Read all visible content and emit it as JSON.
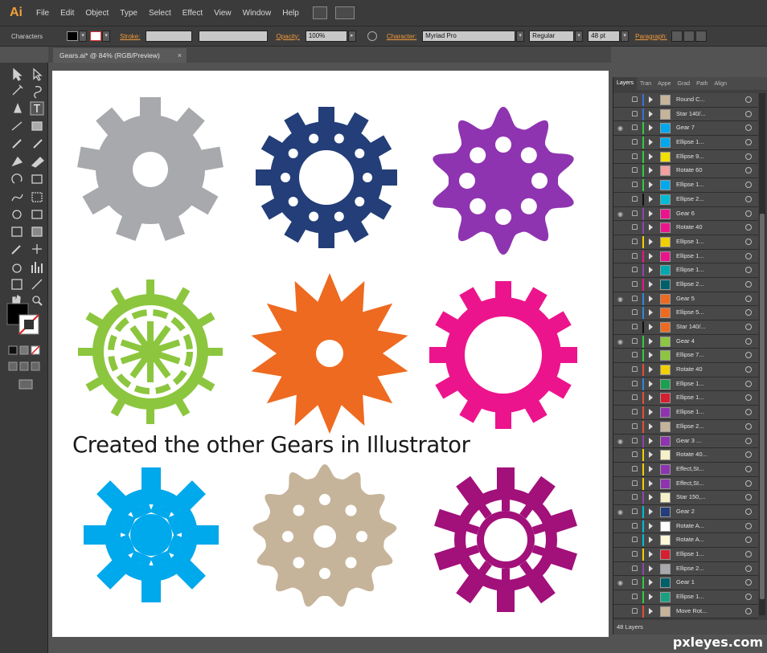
{
  "app": {
    "logo": "Ai"
  },
  "menu": [
    "File",
    "Edit",
    "Object",
    "Type",
    "Select",
    "Effect",
    "View",
    "Window",
    "Help"
  ],
  "control": {
    "panel_label": "Characters",
    "stroke_label": "Stroke:",
    "opacity_label": "Opacity:",
    "opacity_value": "100%",
    "character_label": "Character:",
    "font_family": "Myriad Pro",
    "font_style": "Regular",
    "font_size": "48 pt",
    "paragraph_label": "Paragraph:"
  },
  "document": {
    "tab_title": "Gears.ai* @ 84% (RGB/Preview)",
    "close_symbol": "×"
  },
  "artboard": {
    "caption": "Created the other Gears in Illustrator",
    "gears": [
      {
        "color": "#a7a9ac"
      },
      {
        "color": "#233e78"
      },
      {
        "color": "#8e34b0"
      },
      {
        "color": "#8cc63f"
      },
      {
        "color": "#ee6a20"
      },
      {
        "color": "#ec148c"
      },
      {
        "color": "#00a8ec"
      },
      {
        "color": "#c6b49a"
      },
      {
        "color": "#a2107a"
      }
    ]
  },
  "layers_panel": {
    "tabs": [
      "Layers",
      "Tran",
      "Appe",
      "Grad",
      "Path",
      "Align"
    ],
    "footer": "48 Layers",
    "rows": [
      {
        "name": "Round C...",
        "color": "#3b6fd8",
        "thumb": "#c6b49a",
        "eye": false
      },
      {
        "name": "Star 140/...",
        "color": "#3b6fd8",
        "thumb": "#c6b49a",
        "eye": false
      },
      {
        "name": "Gear 7",
        "color": "#2ecc40",
        "thumb": "#00a8ec",
        "eye": true
      },
      {
        "name": "Ellipse 1...",
        "color": "#2ecc40",
        "thumb": "#00a8ec",
        "eye": false
      },
      {
        "name": "Ellipse 9...",
        "color": "#2ecc40",
        "thumb": "#f2e000",
        "eye": false
      },
      {
        "name": "Rotate 60",
        "color": "#2ecc40",
        "thumb": "#f2a0a0",
        "eye": false
      },
      {
        "name": "Ellipse 1...",
        "color": "#2ecc40",
        "thumb": "#00a8ec",
        "eye": false
      },
      {
        "name": "Ellipse 2...",
        "color": "#111111",
        "thumb": "#00bcd4",
        "eye": false
      },
      {
        "name": "Gear 6",
        "color": "#8e44ad",
        "thumb": "#ec148c",
        "eye": true
      },
      {
        "name": "Rotate 40",
        "color": "#8e44ad",
        "thumb": "#ec148c",
        "eye": false
      },
      {
        "name": "Ellipse 1...",
        "color": "#f2d000",
        "thumb": "#f2d000",
        "eye": false
      },
      {
        "name": "Ellipse 1...",
        "color": "#ec148c",
        "thumb": "#ec148c",
        "eye": false
      },
      {
        "name": "Ellipse 1...",
        "color": "#8e44ad",
        "thumb": "#00a8b0",
        "eye": false
      },
      {
        "name": "Ellipse 2...",
        "color": "#ec148c",
        "thumb": "#00606a",
        "eye": false
      },
      {
        "name": "Gear 5",
        "color": "#2e86de",
        "thumb": "#ee6a20",
        "eye": true
      },
      {
        "name": "Ellipse 5...",
        "color": "#2e86de",
        "thumb": "#ee6a20",
        "eye": false
      },
      {
        "name": "Star 140/...",
        "color": "#111111",
        "thumb": "#ee6a20",
        "eye": false
      },
      {
        "name": "Gear 4",
        "color": "#2ecc40",
        "thumb": "#8cc63f",
        "eye": true
      },
      {
        "name": "Ellipse 7...",
        "color": "#2ecc40",
        "thumb": "#8cc63f",
        "eye": false
      },
      {
        "name": "Rotate 40",
        "color": "#e74c3c",
        "thumb": "#f2d000",
        "eye": false
      },
      {
        "name": "Ellipse 1...",
        "color": "#2e86de",
        "thumb": "#1aa050",
        "eye": false
      },
      {
        "name": "Ellipse 1...",
        "color": "#e74c3c",
        "thumb": "#d42030",
        "eye": false
      },
      {
        "name": "Ellipse 1...",
        "color": "#e74c3c",
        "thumb": "#8e34b0",
        "eye": false
      },
      {
        "name": "Ellipse 2...",
        "color": "#e74c3c",
        "thumb": "#c6b49a",
        "eye": false
      },
      {
        "name": "Gear 3 ...",
        "color": "#8e44ad",
        "thumb": "#8e34b0",
        "eye": true
      },
      {
        "name": "Rotate 40...",
        "color": "#f2d000",
        "thumb": "#f6f0c8",
        "eye": false
      },
      {
        "name": "Effect,St...",
        "color": "#f2d000",
        "thumb": "#8e34b0",
        "eye": false
      },
      {
        "name": "Effect,St...",
        "color": "#f2d000",
        "thumb": "#8e34b0",
        "eye": false
      },
      {
        "name": "Star 150,...",
        "color": "#8e44ad",
        "thumb": "#f6f0c8",
        "eye": false
      },
      {
        "name": "Gear 2",
        "color": "#00bcd4",
        "thumb": "#233e78",
        "eye": true
      },
      {
        "name": "Rotate A...",
        "color": "#00bcd4",
        "thumb": "#ffffff",
        "eye": false
      },
      {
        "name": "Rotate A...",
        "color": "#00bcd4",
        "thumb": "#fff8d8",
        "eye": false
      },
      {
        "name": "Ellipse 1...",
        "color": "#f2d000",
        "thumb": "#d42030",
        "eye": false
      },
      {
        "name": "Ellipse 2...",
        "color": "#8e44ad",
        "thumb": "#a7a9ac",
        "eye": false
      },
      {
        "name": "Gear 1",
        "color": "#2ecc40",
        "thumb": "#00606a",
        "eye": true
      },
      {
        "name": "Ellipse 1...",
        "color": "#2ecc40",
        "thumb": "#1aa080",
        "eye": false
      },
      {
        "name": "Move Rot...",
        "color": "#e74c3c",
        "thumb": "#c6b49a",
        "eye": false
      }
    ]
  },
  "watermark": "pxleyes.com"
}
